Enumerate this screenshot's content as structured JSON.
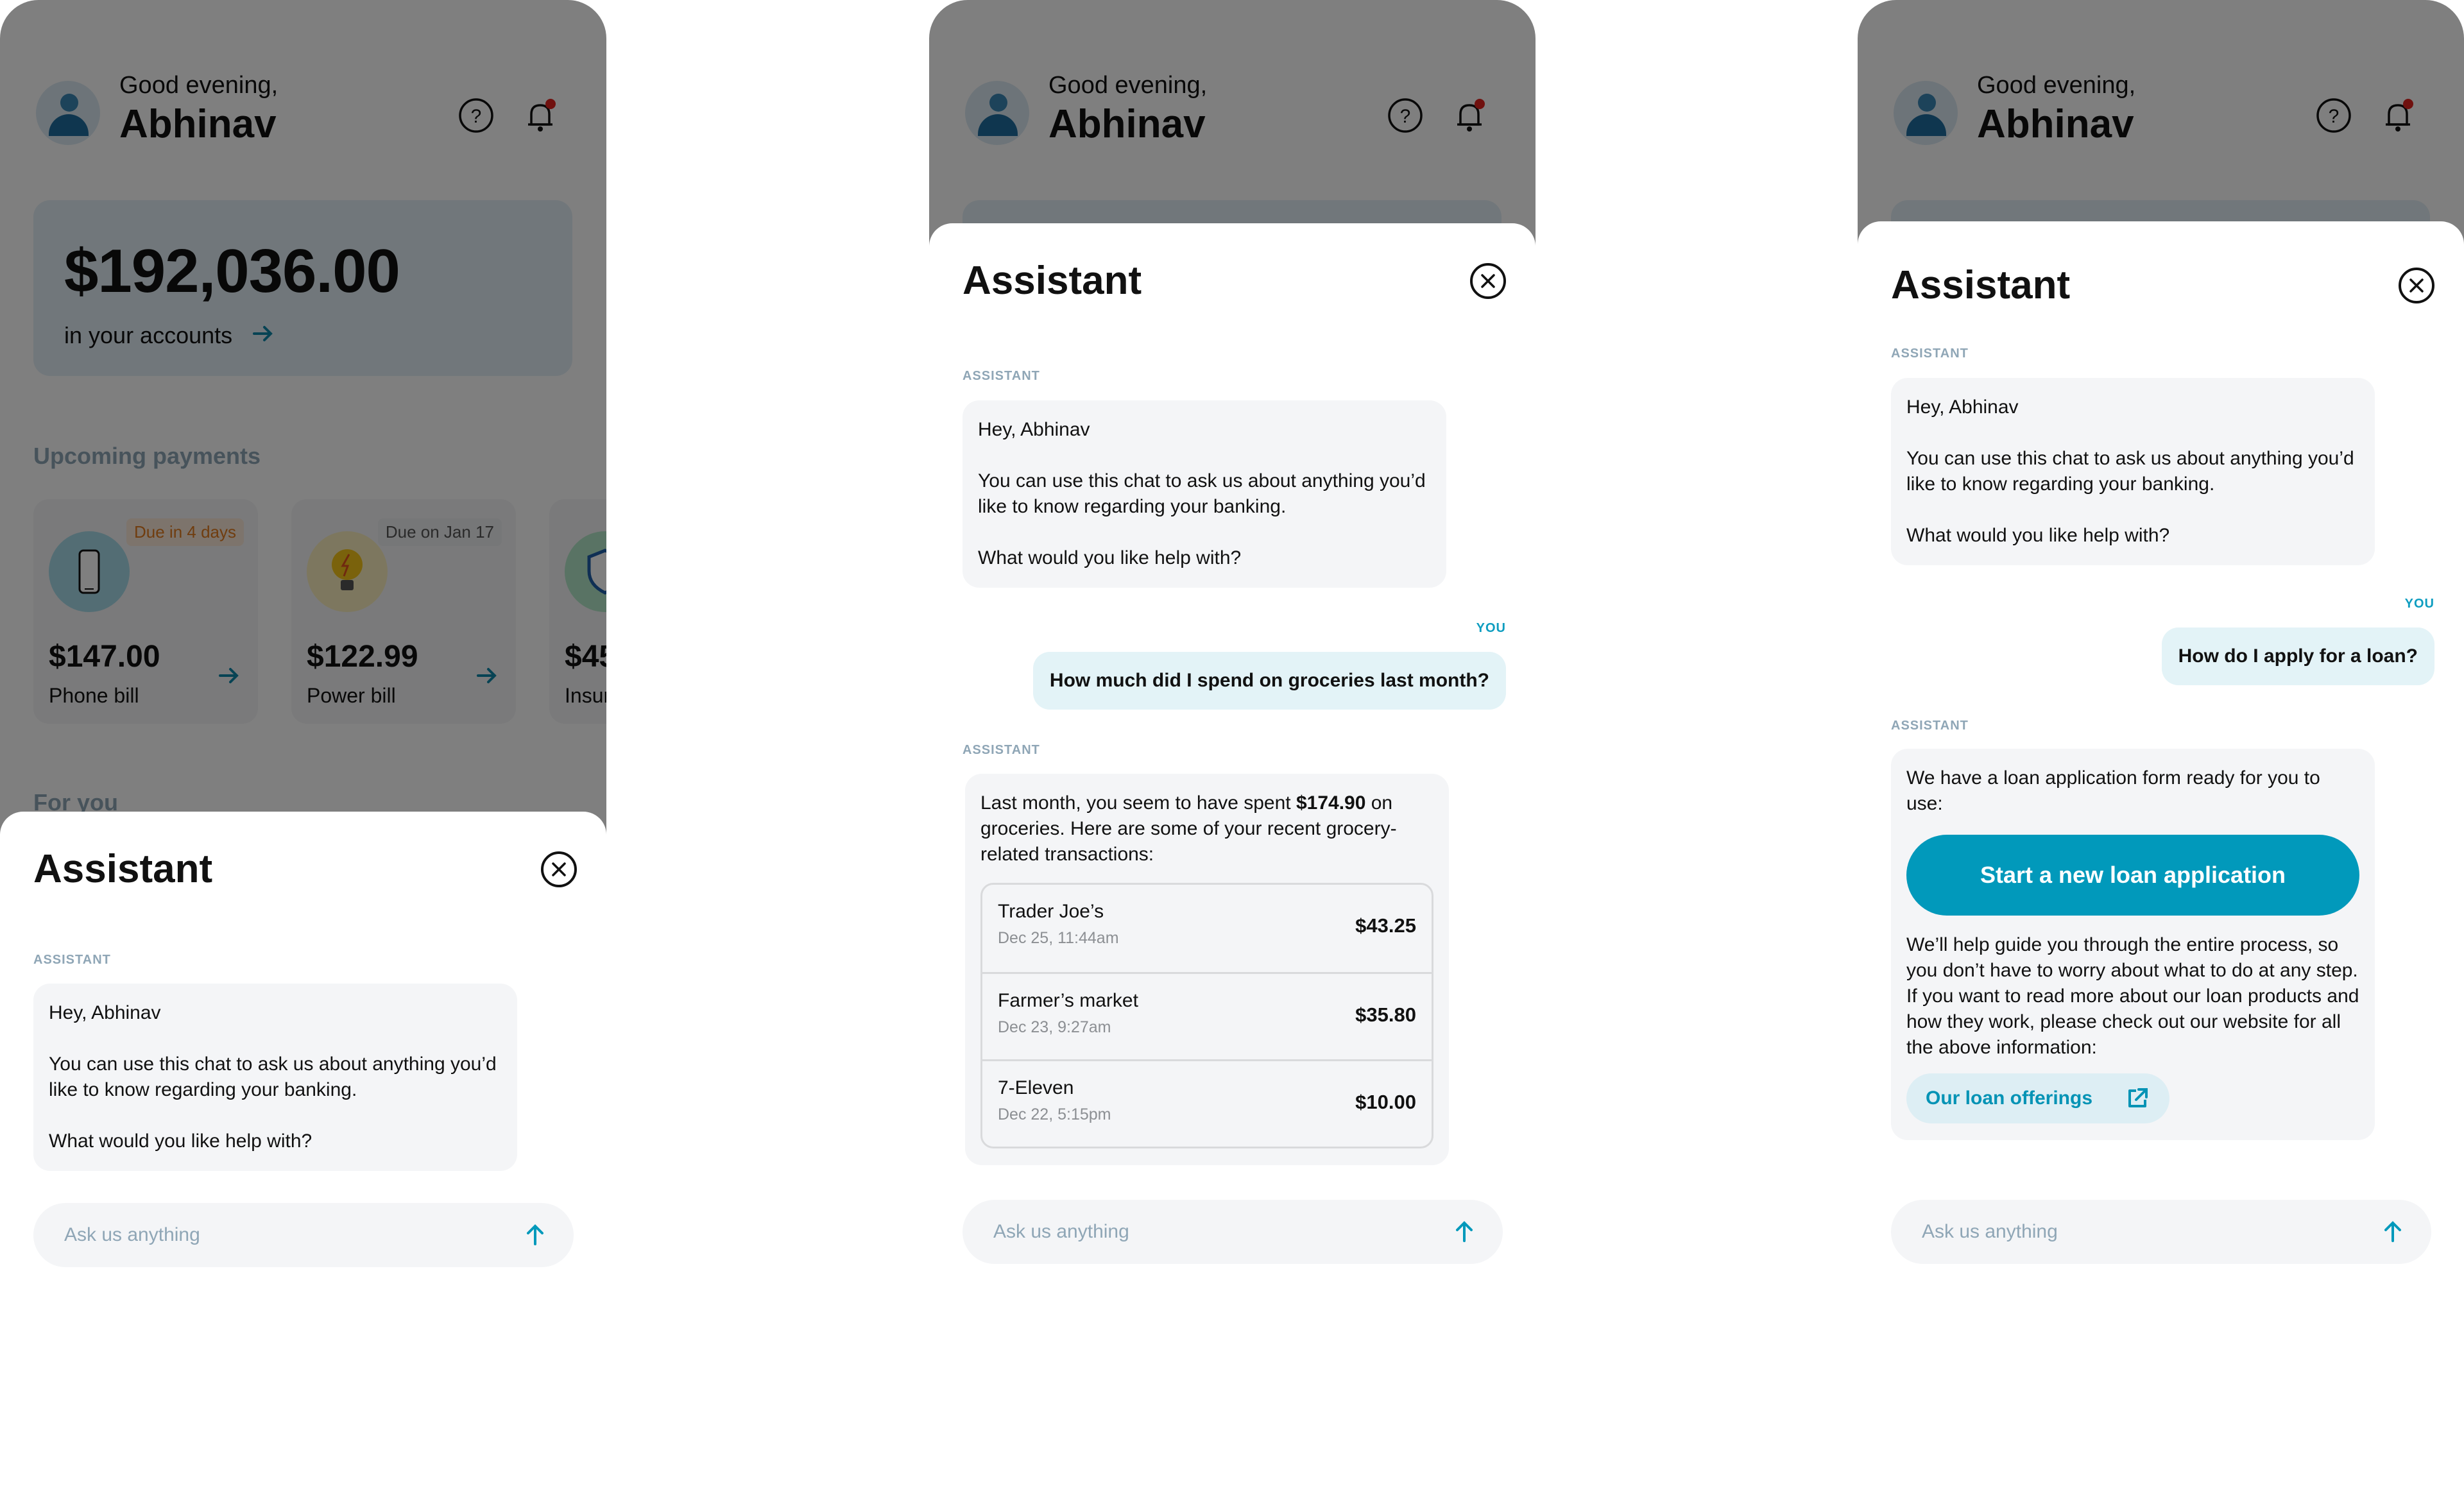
{
  "colors": {
    "accent": "#0199bb",
    "role_assistant": "#8fa6b6",
    "role_you": "#0e9dc0",
    "bubble_assistant": "#f4f5f7",
    "bubble_user": "#e3f3f7",
    "notification_dot": "#e0231f",
    "due_soon": "#e07a1f"
  },
  "home": {
    "greeting": "Good evening,",
    "user_name": "Abhinav",
    "balance": "$192,036.00",
    "balance_caption": "in your accounts",
    "upcoming_title": "Upcoming payments",
    "for_you_title": "For you",
    "payments": [
      {
        "due": "Due in 4 days",
        "amount": "$147.00",
        "label": "Phone bill",
        "icon": "phone-icon"
      },
      {
        "due": "Due on Jan 17",
        "amount": "$122.99",
        "label": "Power bill",
        "icon": "lightbulb-icon"
      },
      {
        "due": "",
        "amount": "$45",
        "label": "Insur",
        "icon": "insurance-shield-icon"
      }
    ]
  },
  "assistant": {
    "title": "Assistant",
    "role_assistant": "ASSISTANT",
    "role_you": "YOU",
    "welcome": {
      "line1": "Hey, Abhinav",
      "line2": "You can use this chat to ask us about anything you’d like to know regarding your banking.",
      "line3": "What would you like help with?"
    },
    "composer_placeholder": "Ask us anything"
  },
  "screen2": {
    "user_question": "How much did I spend on groceries last month?",
    "reply_pre": "Last month, you seem to have spent ",
    "reply_amount": "$174.90",
    "reply_post": " on groceries. Here are some of your recent grocery-related transactions:",
    "transactions": [
      {
        "merchant": "Trader Joe’s",
        "date": "Dec 25, 11:44am",
        "amount": "$43.25"
      },
      {
        "merchant": "Farmer’s market",
        "date": "Dec 23, 9:27am",
        "amount": "$35.80"
      },
      {
        "merchant": "7-Eleven",
        "date": "Dec 22, 5:15pm",
        "amount": "$10.00"
      }
    ]
  },
  "screen3": {
    "user_question": "How do I apply for a loan?",
    "reply_intro": "We have a loan application form ready for you to use:",
    "cta_label": "Start a new loan application",
    "reply_guide": "We’ll help guide you through the entire process, so you don’t have to worry about what to do at any step.",
    "reply_more": "If you want to read more about our loan products and how they work, please check out our website for all the above information:",
    "link_label": "Our loan offerings"
  }
}
